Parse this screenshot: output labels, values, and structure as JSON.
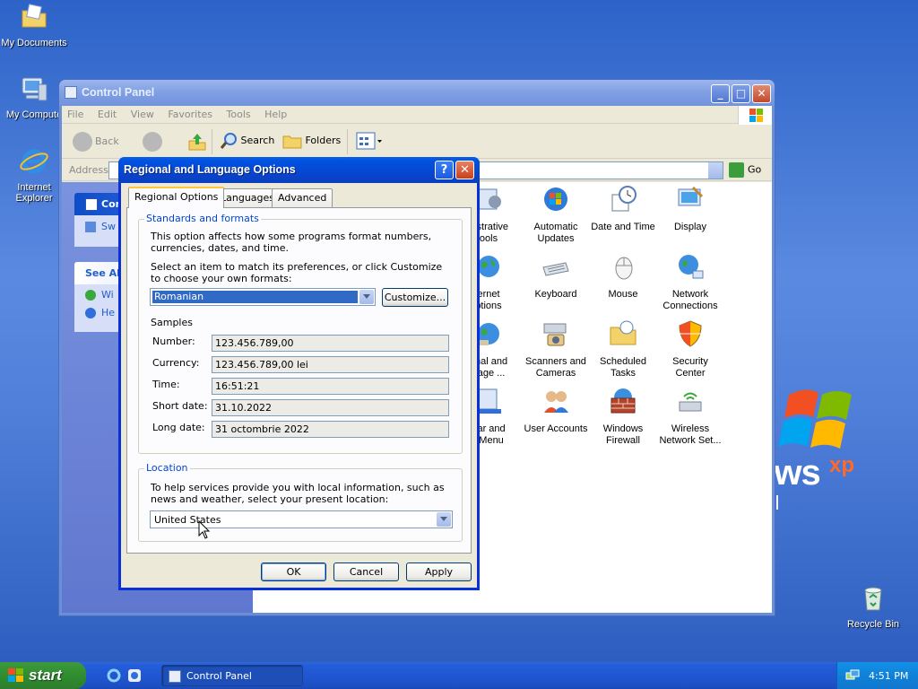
{
  "desktop": {
    "icons": [
      {
        "label": "My Documents"
      },
      {
        "label": "My Compute"
      },
      {
        "label": "Internet Explorer"
      },
      {
        "label": "Recycle Bin"
      }
    ],
    "logo": {
      "windows": "ows",
      "xp": "xp",
      "edition": "nal"
    }
  },
  "cp_window": {
    "title": "Control Panel",
    "menu": [
      "File",
      "Edit",
      "View",
      "Favorites",
      "Tools",
      "Help"
    ],
    "toolbar": {
      "back": "Back",
      "search": "Search",
      "folders": "Folders"
    },
    "address_label": "Address",
    "go_label": "Go",
    "left_pane": {
      "panel1_title": "Con",
      "panel1_item": "Sw",
      "panel2_title": "See Als",
      "panel2_items": [
        "Wi",
        "He"
      ]
    },
    "items": [
      {
        "label": "nistrative\nools"
      },
      {
        "label": "Automatic\nUpdates"
      },
      {
        "label": "Date and Time"
      },
      {
        "label": "Display"
      },
      {
        "label": "ernet\nptions"
      },
      {
        "label": "Keyboard"
      },
      {
        "label": "Mouse"
      },
      {
        "label": "Network\nConnections"
      },
      {
        "label": "onal and\nuage ..."
      },
      {
        "label": "Scanners and\nCameras"
      },
      {
        "label": "Scheduled\nTasks"
      },
      {
        "label": "Security\nCenter"
      },
      {
        "label": "bar and\nt Menu"
      },
      {
        "label": "User Accounts"
      },
      {
        "label": "Windows\nFirewall"
      },
      {
        "label": "Wireless\nNetwork Set..."
      }
    ]
  },
  "dialog": {
    "title": "Regional and Language Options",
    "help_label": "?",
    "close_label": "✕",
    "tabs": [
      "Regional Options",
      "Languages",
      "Advanced"
    ],
    "standards": {
      "legend": "Standards and formats",
      "desc": "This option affects how some programs format numbers, currencies, dates, and time.",
      "select_text": "Select an item to match its preferences, or click Customize to choose your own formats:",
      "selected_format": "Romanian",
      "customize_label": "Customize...",
      "samples_label": "Samples",
      "samples": [
        {
          "label": "Number:",
          "value": "123.456.789,00"
        },
        {
          "label": "Currency:",
          "value": "123.456.789,00 lei"
        },
        {
          "label": "Time:",
          "value": "16:51:21"
        },
        {
          "label": "Short date:",
          "value": "31.10.2022"
        },
        {
          "label": "Long date:",
          "value": "31 octombrie 2022"
        }
      ]
    },
    "location": {
      "legend": "Location",
      "desc": "To help services provide you with local information, such as news and weather, select your present location:",
      "value": "United States"
    },
    "buttons": {
      "ok": "OK",
      "cancel": "Cancel",
      "apply": "Apply"
    }
  },
  "taskbar": {
    "start_label": "start",
    "task_label": "Control Panel",
    "clock": "4:51 PM"
  },
  "colors": {
    "accent": "#0831d9",
    "desktop": "#3a6ea5"
  }
}
